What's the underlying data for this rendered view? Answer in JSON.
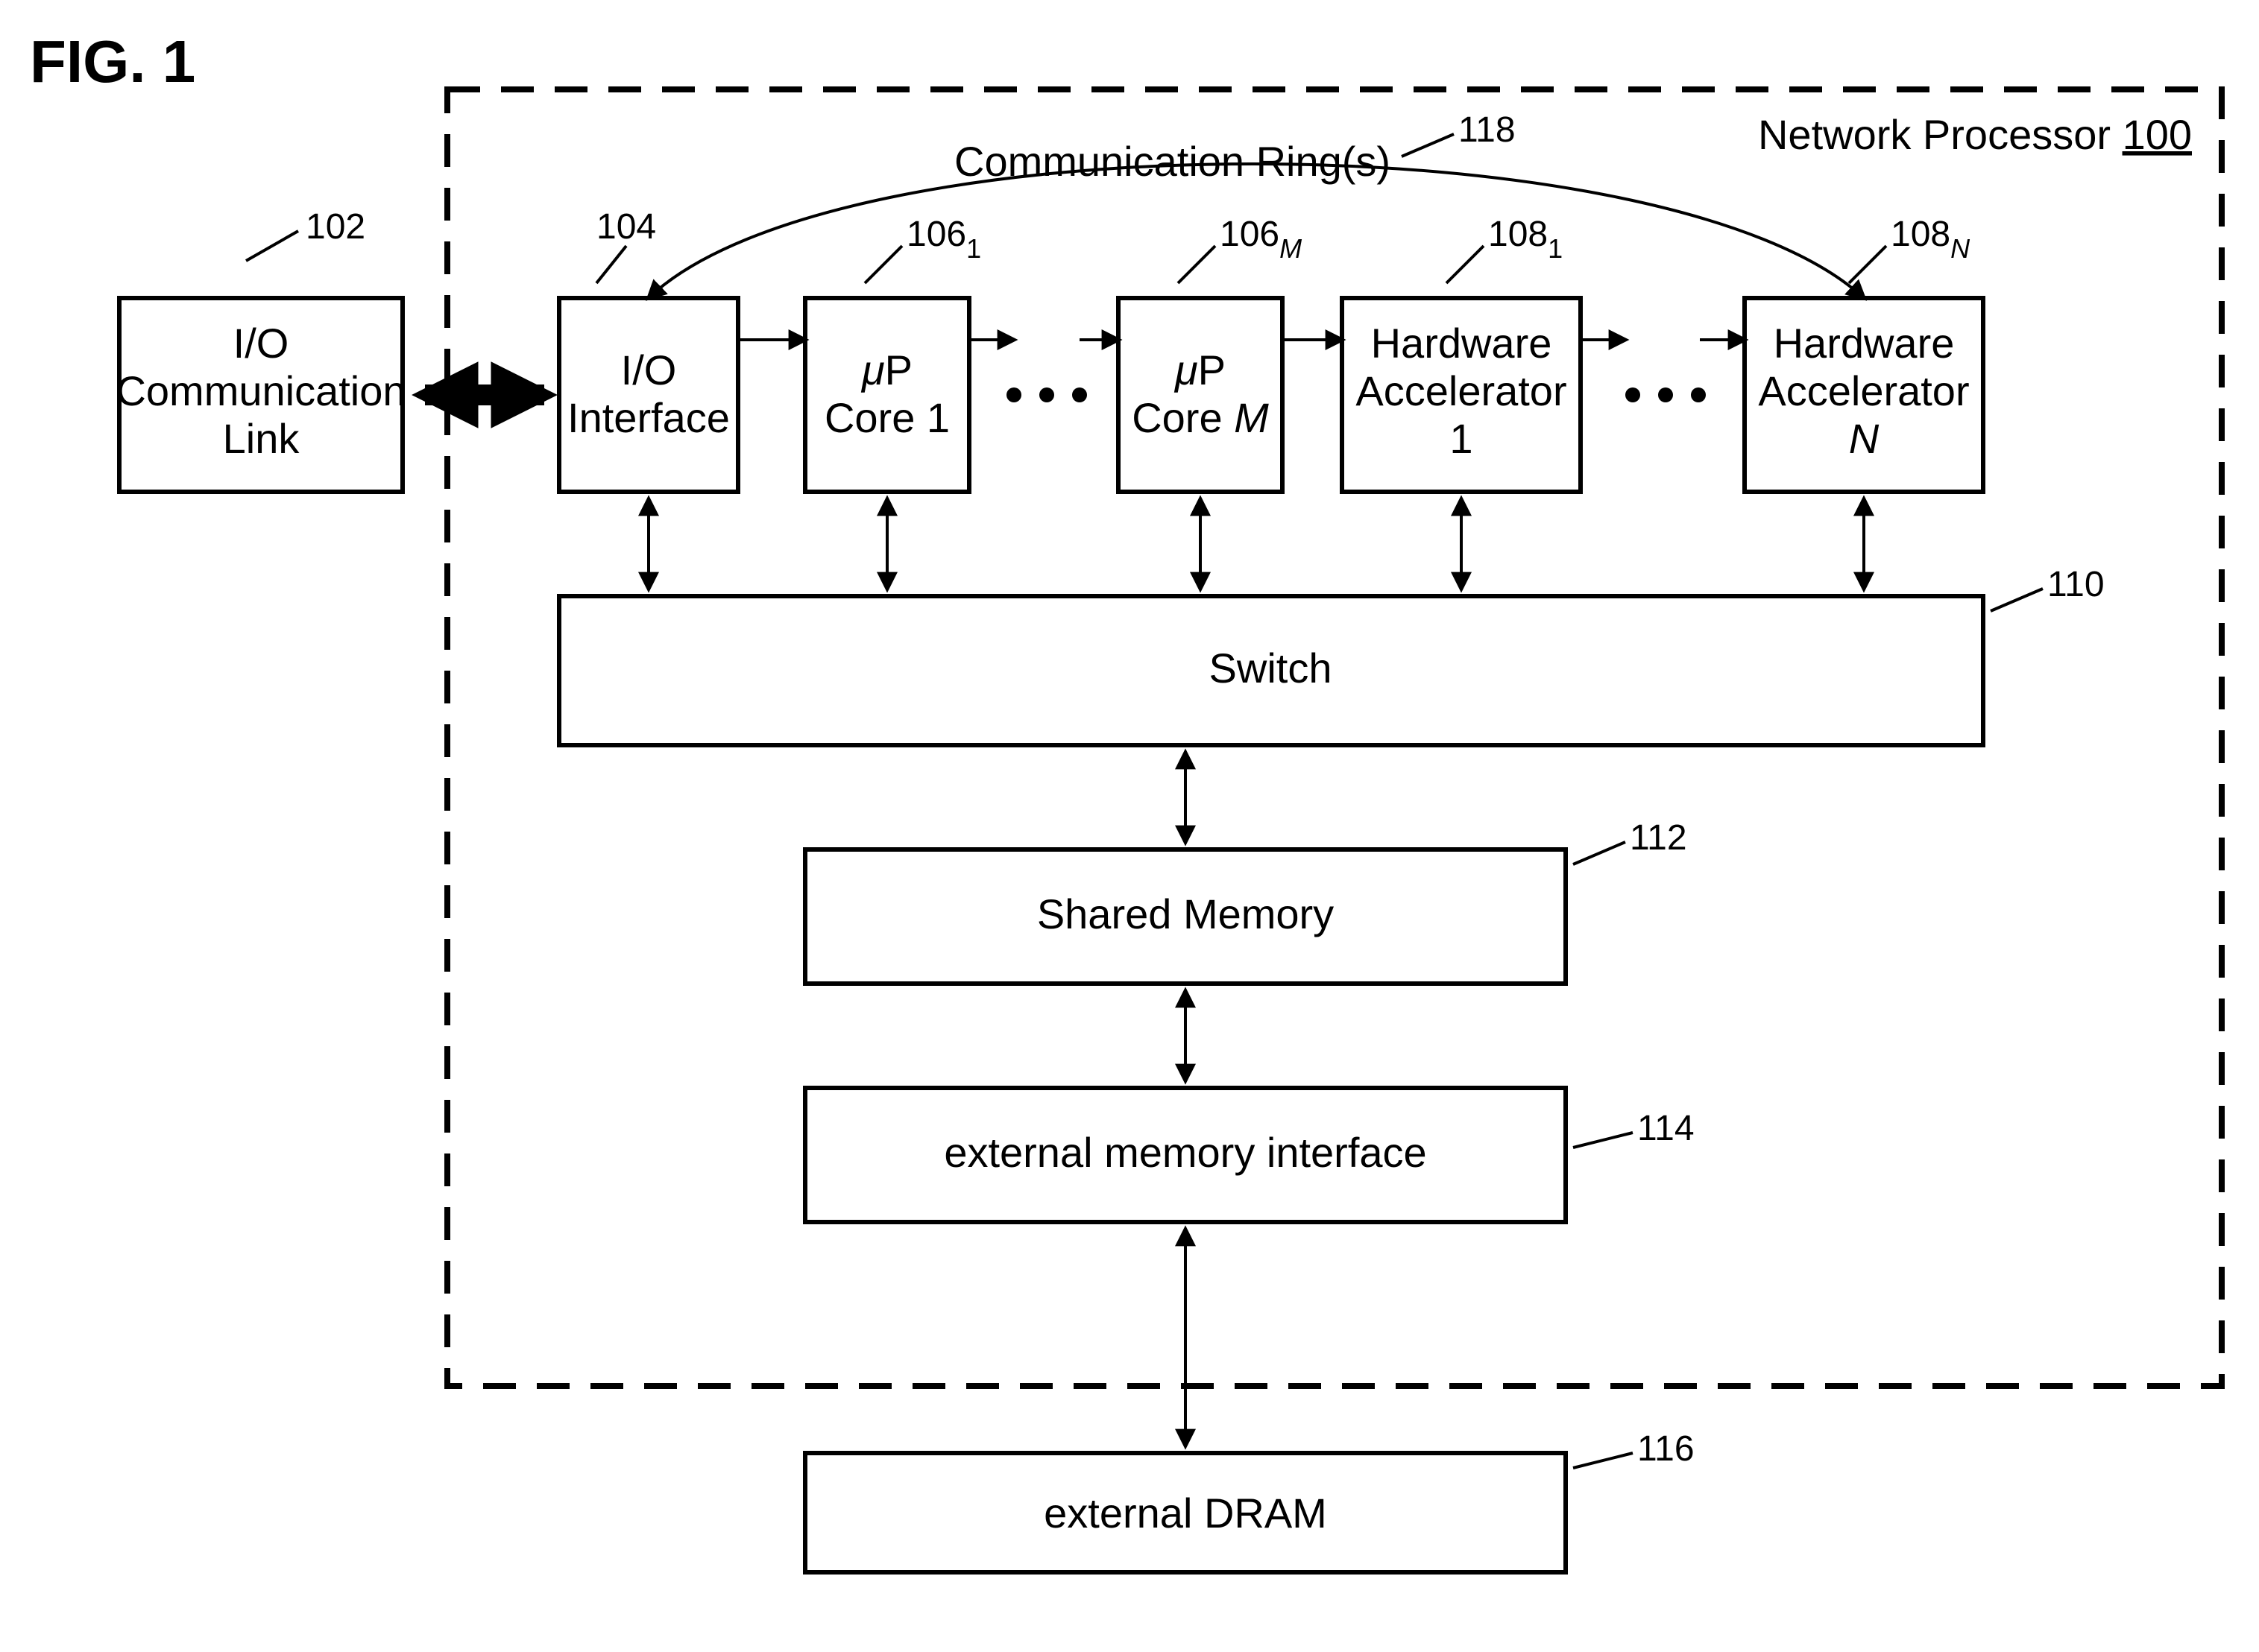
{
  "figure_label": "FIG. 1",
  "outer": {
    "title_prefix": "Network Processor ",
    "title_ref": "100"
  },
  "refs": {
    "io_link": "102",
    "io_interface": "104",
    "core1": "106",
    "core1_sub": "1",
    "coreM": "106",
    "coreM_sub": "M",
    "accel1": "108",
    "accel1_sub": "1",
    "accelN": "108",
    "accelN_sub": "N",
    "switch": "110",
    "shared_mem": "112",
    "emi": "114",
    "dram": "116",
    "ring": "118"
  },
  "labels": {
    "io_link": [
      "I/O",
      "Communication",
      "Link"
    ],
    "io_interface": [
      "I/O",
      "Interface"
    ],
    "core1": [
      "μP",
      "Core 1"
    ],
    "coreM_pre": "μP",
    "coreM_post": [
      "Core ",
      "M"
    ],
    "accel1": [
      "Hardware",
      "Accelerator",
      "1"
    ],
    "accelN": [
      "Hardware",
      "Accelerator"
    ],
    "accelN_N": "N",
    "switch": "Switch",
    "shared_mem": "Shared Memory",
    "emi": "external memory interface",
    "dram": "external DRAM",
    "ring": "Communication Ring(s)"
  }
}
